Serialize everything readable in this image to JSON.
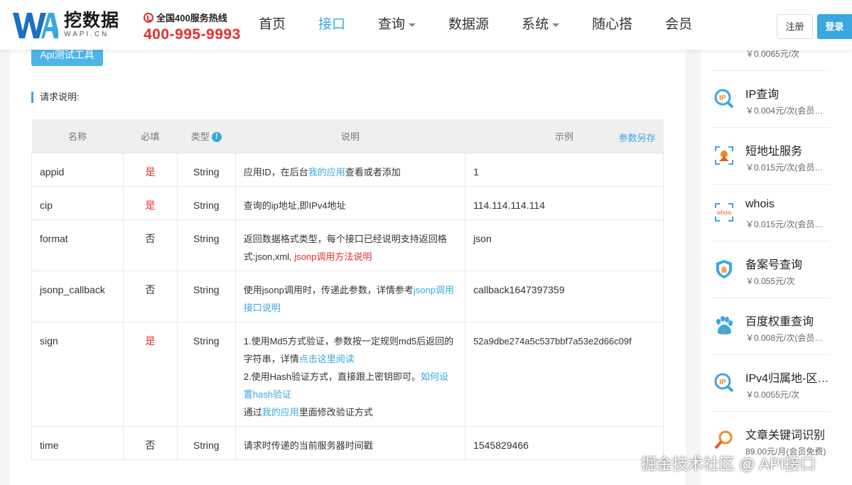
{
  "header": {
    "logo_text": "挖数据",
    "logo_sub": "WAPI.CN",
    "hotline_label": "全国400服务热线",
    "hotline_number": "400-995-9993",
    "nav": [
      {
        "label": "首页"
      },
      {
        "label": "接口"
      },
      {
        "label": "查询"
      },
      {
        "label": "数据源"
      },
      {
        "label": "系统"
      },
      {
        "label": "随心搭"
      },
      {
        "label": "会员"
      }
    ],
    "register_label": "注册",
    "login_label": "登录"
  },
  "main": {
    "api_tool_label": "Api测试工具",
    "section_title": "请求说明:",
    "table": {
      "headers": {
        "name": "名称",
        "required": "必填",
        "type": "类型",
        "type_info": "!",
        "desc": "说明",
        "example": "示例",
        "save": "参数另存"
      },
      "rows": [
        {
          "name": "appid",
          "required": "是",
          "type": "String",
          "desc_a": "应用ID，在后台",
          "desc_link": "我的应用",
          "desc_b": "查看或者添加",
          "example": "1"
        },
        {
          "name": "cip",
          "required": "是",
          "type": "String",
          "desc_a": "查询的ip地址,即IPv4地址",
          "example": "114.114.114.114"
        },
        {
          "name": "format",
          "required": "否",
          "type": "String",
          "desc_a": "返回数据格式类型，每个接口已经说明支持返回格式:json,xml,",
          "desc_link": "jsonp调用方法说明",
          "example": "json"
        },
        {
          "name": "jsonp_callback",
          "required": "否",
          "type": "String",
          "desc_a": "使用jsonp调用时，传递此参数，详情参考",
          "desc_link": "jsonp调用接口说明",
          "example": "callback1647397359"
        },
        {
          "name": "sign",
          "required": "是",
          "type": "String",
          "desc_a": "1.使用Md5方式验证，参数按一定规则md5后返回的字符串，详情",
          "desc_link": "点击这里阅读",
          "desc_b": "2.使用Hash验证方式，直接跟上密钥即可。",
          "desc_link2": "如何设置hash验证",
          "desc_c": "通过",
          "desc_link3": "我的应用",
          "desc_d": "里面修改验证方式",
          "example": "52a9dbe274a5c537bbf7a53e2d66c09f"
        },
        {
          "name": "time",
          "required": "否",
          "type": "String",
          "desc_a": "请求时传递的当前服务器时间戳",
          "example": "1545829466"
        }
      ]
    }
  },
  "sidebar": {
    "items": [
      {
        "name": "",
        "price": "￥0.0065元/次",
        "icon": "partial-icon"
      },
      {
        "name": "IP查询",
        "price": "￥0.004元/次(会员…",
        "icon": "ip-search-icon"
      },
      {
        "name": "短地址服务",
        "price": "￥0.015元/次(会员…",
        "icon": "short-url-icon"
      },
      {
        "name": "whois",
        "price": "￥0.015元/次(会员…",
        "icon": "whois-icon"
      },
      {
        "name": "备案号查询",
        "price": "￥0.055元/次",
        "icon": "beian-shield-icon"
      },
      {
        "name": "百度权重查询",
        "price": "￥0.008元/次(会员…",
        "icon": "baidu-paw-icon"
      },
      {
        "name": "IPv4归属地-区…",
        "price": "￥0.0055元/次",
        "icon": "ip-search-icon"
      },
      {
        "name": "文章关键词识别",
        "price": "89.00元/月(会员免费)",
        "icon": "keyword-search-icon"
      }
    ]
  },
  "watermark": "掘金技术社区 @ API接口",
  "colors": {
    "accent": "#3aa7e0",
    "danger": "#e52e2e"
  }
}
